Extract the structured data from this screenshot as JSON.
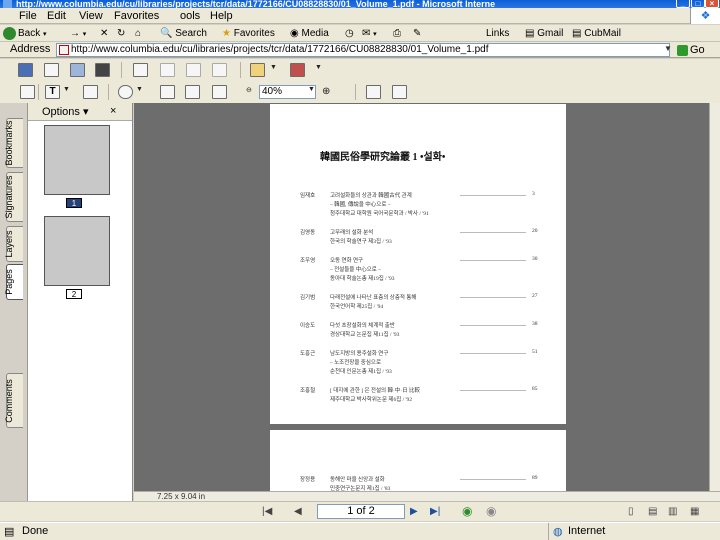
{
  "title_bar": {
    "title": "http://www.columbia.edu/cu/libraries/projects/tcr/data/1772166/CU08828830/01_Volume_1.pdf - Microsoft Interne"
  },
  "menu": [
    "File",
    "Edit",
    "View",
    "Favorites",
    "ools",
    "Help"
  ],
  "nav_toolbar": {
    "back": "Back",
    "search": "Search",
    "favorites": "Favorites",
    "media": "Media",
    "links": "Links",
    "gmail": "Gmail",
    "cubmail": "CubMail"
  },
  "address": {
    "label": "Address",
    "url": "http://www.columbia.edu/cu/libraries/projects/tcr/data/1772166/CU08828830/01_Volume_1.pdf",
    "go": "Go"
  },
  "pdf_toolbar": {
    "text_tool": "T",
    "zoom": "40%"
  },
  "side_tabs": [
    "Bookmarks",
    "Signatures",
    "Layers",
    "Pages",
    "Comments"
  ],
  "thumb_panel": {
    "options": "Options",
    "close": "×",
    "pages": [
      "1",
      "2"
    ]
  },
  "page_size": "7.25 x 9.04 in",
  "navigation": {
    "page_indicator": "1 of 2"
  },
  "status": {
    "left": "Done",
    "zone": "Internet"
  },
  "document": {
    "heading": "韓國民俗學研究論叢  1  •설화•",
    "entries": [
      {
        "author": "임재호",
        "lines": [
          "고려설화들의 상관과 韓國古代 관계",
          "– 韓國, 傳說을 中心으로 –",
          "청주대학교 대학원 국어국문학과 / 박사 / '91"
        ],
        "page": "3"
      },
      {
        "author": "김영동",
        "lines": [
          "고무래의 설화 분석",
          "한국의 학술연구 제3집 / '93"
        ],
        "page": "20"
      },
      {
        "author": "조우영",
        "lines": [
          "오동 연화 연구",
          "– 전설들을 中心으로 –",
          "동아대 학술논총 제19집 / '93"
        ],
        "page": "30"
      },
      {
        "author": "김기범",
        "lines": [
          "다래전설에 나타난 표층의 상층적 통해",
          "한국언어학 제25집 / '94"
        ],
        "page": "27"
      },
      {
        "author": "이승도",
        "lines": [
          "다섯 초장설화의 체계적 출반",
          "경상대학교 논문집 제11집 / '93"
        ],
        "page": "38"
      },
      {
        "author": "도흥근",
        "lines": [
          "남도지방의 용주설화 연구",
          "– 노조전장을 중심으로",
          "순천대 인문논총 제1집 / '93"
        ],
        "page": "51"
      },
      {
        "author": "조홍철",
        "lines": [
          "[ 대지에 관한 ] 은 전설의 韓·中·日 比較",
          "제주대학교 박사학위논문 제6집 / '92"
        ],
        "page": "85"
      }
    ],
    "page2_entry": {
      "author": "장정용",
      "lines": [
        "동해안 마을 신앙과 설화",
        "민중연구논문지 제1집 / '83"
      ],
      "page": "89"
    }
  }
}
